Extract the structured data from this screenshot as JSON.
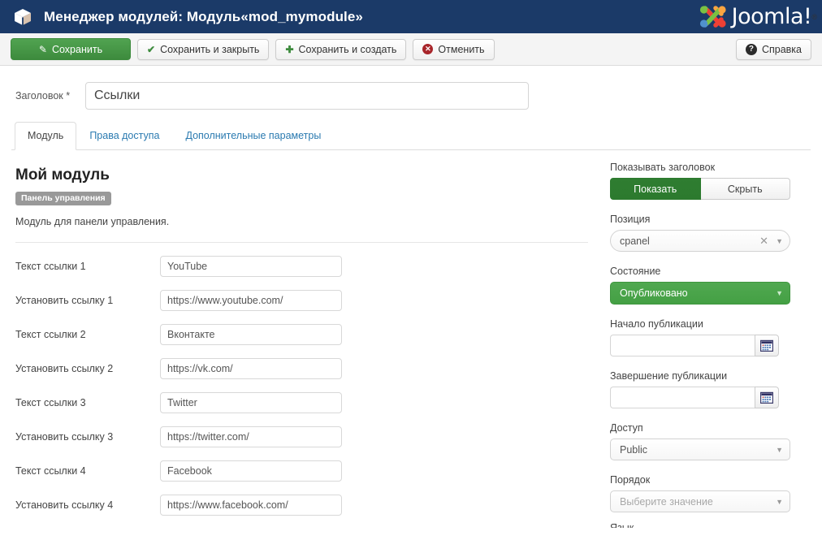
{
  "header": {
    "icon": "cube-icon",
    "title": "Менеджер модулей: Модуль«mod_mymodule»",
    "brand": "Joomla!",
    "brand_mark": "®",
    "bg_color": "#1b3a68"
  },
  "toolbar": {
    "save_label": "Сохранить",
    "save_icon": "pencil-square-icon",
    "save_close_label": "Сохранить и закрыть",
    "save_close_icon": "check-icon",
    "save_new_label": "Сохранить и создать",
    "save_new_icon": "plus-icon",
    "cancel_label": "Отменить",
    "cancel_icon": "circle-x-icon",
    "help_label": "Справка",
    "help_icon": "circle-question-icon",
    "primary_color": "#3d8b3d"
  },
  "title_field": {
    "label": "Заголовок *",
    "value": "Ссылки",
    "placeholder": ""
  },
  "tabs": [
    {
      "label": "Модуль",
      "active": true
    },
    {
      "label": "Права доступа",
      "active": false
    },
    {
      "label": "Дополнительные параметры",
      "active": false
    }
  ],
  "module": {
    "heading": "Мой модуль",
    "badge": "Панель управления",
    "description": "Модуль для панели управления."
  },
  "fields": [
    {
      "label": "Текст ссылки 1",
      "value": "YouTube"
    },
    {
      "label": "Установить ссылку 1",
      "value": "https://www.youtube.com/"
    },
    {
      "label": "Текст ссылки 2",
      "value": "Вконтакте"
    },
    {
      "label": "Установить ссылку 2",
      "value": "https://vk.com/"
    },
    {
      "label": "Текст ссылки 3",
      "value": "Twitter"
    },
    {
      "label": "Установить ссылку 3",
      "value": "https://twitter.com/"
    },
    {
      "label": "Текст ссылки 4",
      "value": "Facebook"
    },
    {
      "label": "Установить ссылку 4",
      "value": "https://www.facebook.com/"
    }
  ],
  "sidebar": {
    "show_title": {
      "label": "Показывать заголовок",
      "show_label": "Показать",
      "hide_label": "Скрыть",
      "selected": "Показать"
    },
    "position": {
      "label": "Позиция",
      "value": "cpanel",
      "clear_icon": "close-icon",
      "caret_icon": "chevron-down-icon"
    },
    "status": {
      "label": "Состояние",
      "value": "Опубликовано",
      "color": "#47a247",
      "caret_icon": "chevron-down-icon"
    },
    "publish_up": {
      "label": "Начало публикации",
      "value": "",
      "placeholder": "",
      "calendar_icon": "calendar-icon"
    },
    "publish_down": {
      "label": "Завершение публикации",
      "value": "",
      "placeholder": "",
      "calendar_icon": "calendar-icon"
    },
    "access": {
      "label": "Доступ",
      "value": "Public",
      "caret_icon": "chevron-down-icon"
    },
    "ordering": {
      "label": "Порядок",
      "value": "Выберите значение",
      "caret_icon": "chevron-down-icon"
    },
    "language": {
      "label": "Язык"
    }
  }
}
